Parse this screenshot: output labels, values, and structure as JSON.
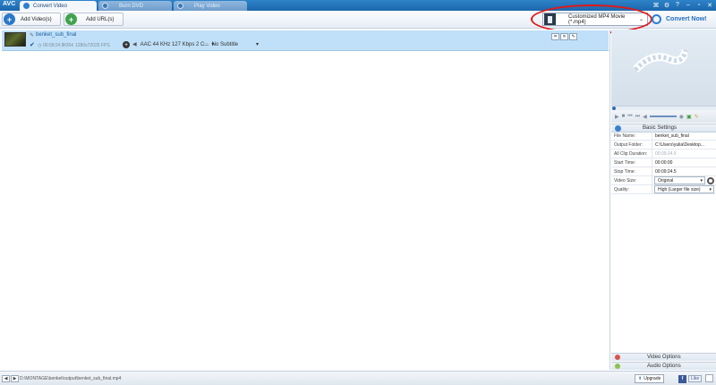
{
  "app": {
    "logo": "AVC"
  },
  "tabs": [
    {
      "label": "Convert Video"
    },
    {
      "label": "Burn DVD"
    },
    {
      "label": "Play Video"
    }
  ],
  "window_controls": [
    "⌘",
    "⚙",
    "?",
    "–",
    "▫",
    "✕"
  ],
  "toolbar": {
    "add_videos": "Add Video(s)",
    "add_urls": "Add URL(s)",
    "profile": "Customized MP4 Movie (*.mp4)",
    "convert_now": "Convert Now!"
  },
  "file": {
    "name": "benket_sub_final",
    "duration": "00:09:24.5",
    "codec": "H264",
    "resolution": "1280x720",
    "fps": "25 FPS",
    "audio": "AAC 44 KHz 127 Kbps 2 C...",
    "subtitle": "No Subtitle"
  },
  "settings": {
    "header": "Basic Settings",
    "rows": [
      {
        "label": "File Name:",
        "value": "benket_sub_final"
      },
      {
        "label": "Output Folder:",
        "value": "C:\\Users\\yulia\\Desktop..."
      },
      {
        "label": "All Clip Duration:",
        "value": "00:09:24.5"
      },
      {
        "label": "Start Time:",
        "value": "00:00:00"
      },
      {
        "label": "Stop Time:",
        "value": "00:09:24.5"
      },
      {
        "label": "Video Size:",
        "value": "Original"
      },
      {
        "label": "Quality:",
        "value": "High (Larger file size)"
      }
    ]
  },
  "panels": {
    "video_options": "Video Options",
    "audio_options": "Audio Options"
  },
  "status": {
    "path": "D:\\MONTAGE\\benket\\output\\benket_sub_final.mp4",
    "upgrade": "Upgrade",
    "like": "Like"
  },
  "colors": {
    "accent": "#1c67ad",
    "selected_row": "#bfe0f8",
    "annotation": "#e01818"
  }
}
